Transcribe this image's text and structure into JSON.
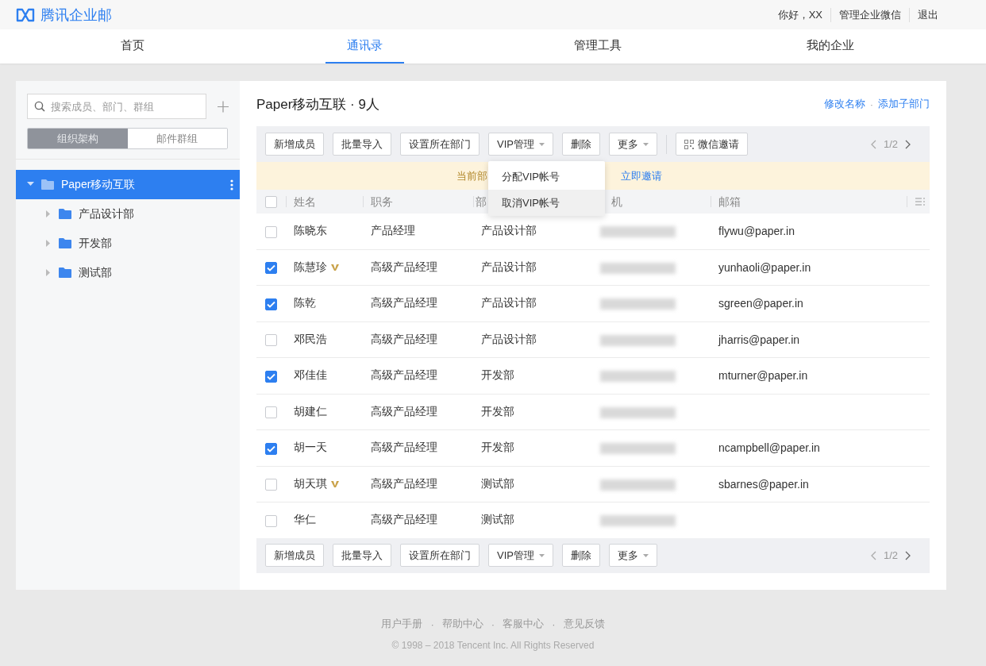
{
  "brand": {
    "name": "腾讯企业邮"
  },
  "user_bar": {
    "greeting": "你好，XX",
    "links": [
      "管理企业微信",
      "退出"
    ]
  },
  "nav_tabs": [
    {
      "label": "首页",
      "selected": false
    },
    {
      "label": "通讯录",
      "selected": true
    },
    {
      "label": "管理工具",
      "selected": false
    },
    {
      "label": "我的企业",
      "selected": false
    }
  ],
  "sidebar": {
    "search": {
      "placeholder": "搜索成员、部门、群组"
    },
    "mode_tabs": [
      {
        "label": "组织架构",
        "selected": true
      },
      {
        "label": "邮件群组",
        "selected": false
      }
    ],
    "tree": [
      {
        "label": "Paper移动互联",
        "selected": true,
        "expanded": true,
        "children": [
          {
            "label": "产品设计部",
            "selected": false,
            "expanded": false
          },
          {
            "label": "开发部",
            "selected": false,
            "expanded": false
          },
          {
            "label": "测试部",
            "selected": false,
            "expanded": false
          }
        ]
      }
    ]
  },
  "content": {
    "title": "Paper移动互联 · 9人",
    "actions": [
      "修改名称",
      "添加子部门"
    ],
    "action_separator": "·",
    "toolbar_top": {
      "buttons": [
        {
          "label": "新增成员",
          "kind": "plain"
        },
        {
          "label": "批量导入",
          "kind": "plain"
        },
        {
          "label": "设置所在部门",
          "kind": "plain"
        },
        {
          "label": "VIP管理",
          "kind": "dropdown"
        },
        {
          "label": "删除",
          "kind": "plain"
        },
        {
          "label": "更多",
          "kind": "dropdown"
        },
        {
          "label": "微信邀请",
          "kind": "qr"
        }
      ],
      "pager": "1/2"
    },
    "dropdown_menu": {
      "items": [
        {
          "label": "分配VIP帐号",
          "selected": false
        },
        {
          "label": "取消VIP帐号",
          "selected": true
        }
      ]
    },
    "notice": {
      "text": "当前部",
      "link": "立即邀请"
    },
    "table": {
      "all_checked": false,
      "columns": [
        "姓名",
        "职务",
        "部",
        "机",
        "邮箱"
      ],
      "rows": [
        {
          "checked": false,
          "name": "陈晓东",
          "vip": false,
          "title": "产品经理",
          "department": "产品设计部",
          "email": "flywu@paper.in"
        },
        {
          "checked": true,
          "name": "陈慧珍",
          "vip": true,
          "title": "高级产品经理",
          "department": "产品设计部",
          "email": "yunhaoli@paper.in"
        },
        {
          "checked": true,
          "name": "陈乾",
          "vip": false,
          "title": "高级产品经理",
          "department": "产品设计部",
          "email": "sgreen@paper.in"
        },
        {
          "checked": false,
          "name": "邓民浩",
          "vip": false,
          "title": "高级产品经理",
          "department": "产品设计部",
          "email": "jharris@paper.in"
        },
        {
          "checked": true,
          "name": "邓佳佳",
          "vip": false,
          "title": "高级产品经理",
          "department": "开发部",
          "email": "mturner@paper.in"
        },
        {
          "checked": false,
          "name": "胡建仁",
          "vip": false,
          "title": "高级产品经理",
          "department": "开发部"
        },
        {
          "checked": true,
          "name": "胡一天",
          "vip": false,
          "title": "高级产品经理",
          "department": "开发部",
          "email": "ncampbell@paper.in"
        },
        {
          "checked": false,
          "name": "胡天琪",
          "vip": true,
          "title": "高级产品经理",
          "department": "测试部",
          "email": "sbarnes@paper.in"
        },
        {
          "checked": false,
          "name": "华仁",
          "vip": false,
          "title": "高级产品经理",
          "department": "测试部"
        }
      ]
    },
    "toolbar_bottom": {
      "buttons": [
        {
          "label": "新增成员",
          "kind": "plain"
        },
        {
          "label": "批量导入",
          "kind": "plain"
        },
        {
          "label": "设置所在部门",
          "kind": "plain"
        },
        {
          "label": "VIP管理",
          "kind": "dropdown"
        },
        {
          "label": "删除",
          "kind": "plain"
        },
        {
          "label": "更多",
          "kind": "dropdown"
        }
      ],
      "pager": "1/2"
    }
  },
  "footer": {
    "links": [
      "用户手册",
      "帮助中心",
      "客服中心",
      "意见反馈"
    ],
    "separator": "·",
    "copyright": "© 1998 – 2018 Tencent Inc. All Rights Reserved"
  }
}
